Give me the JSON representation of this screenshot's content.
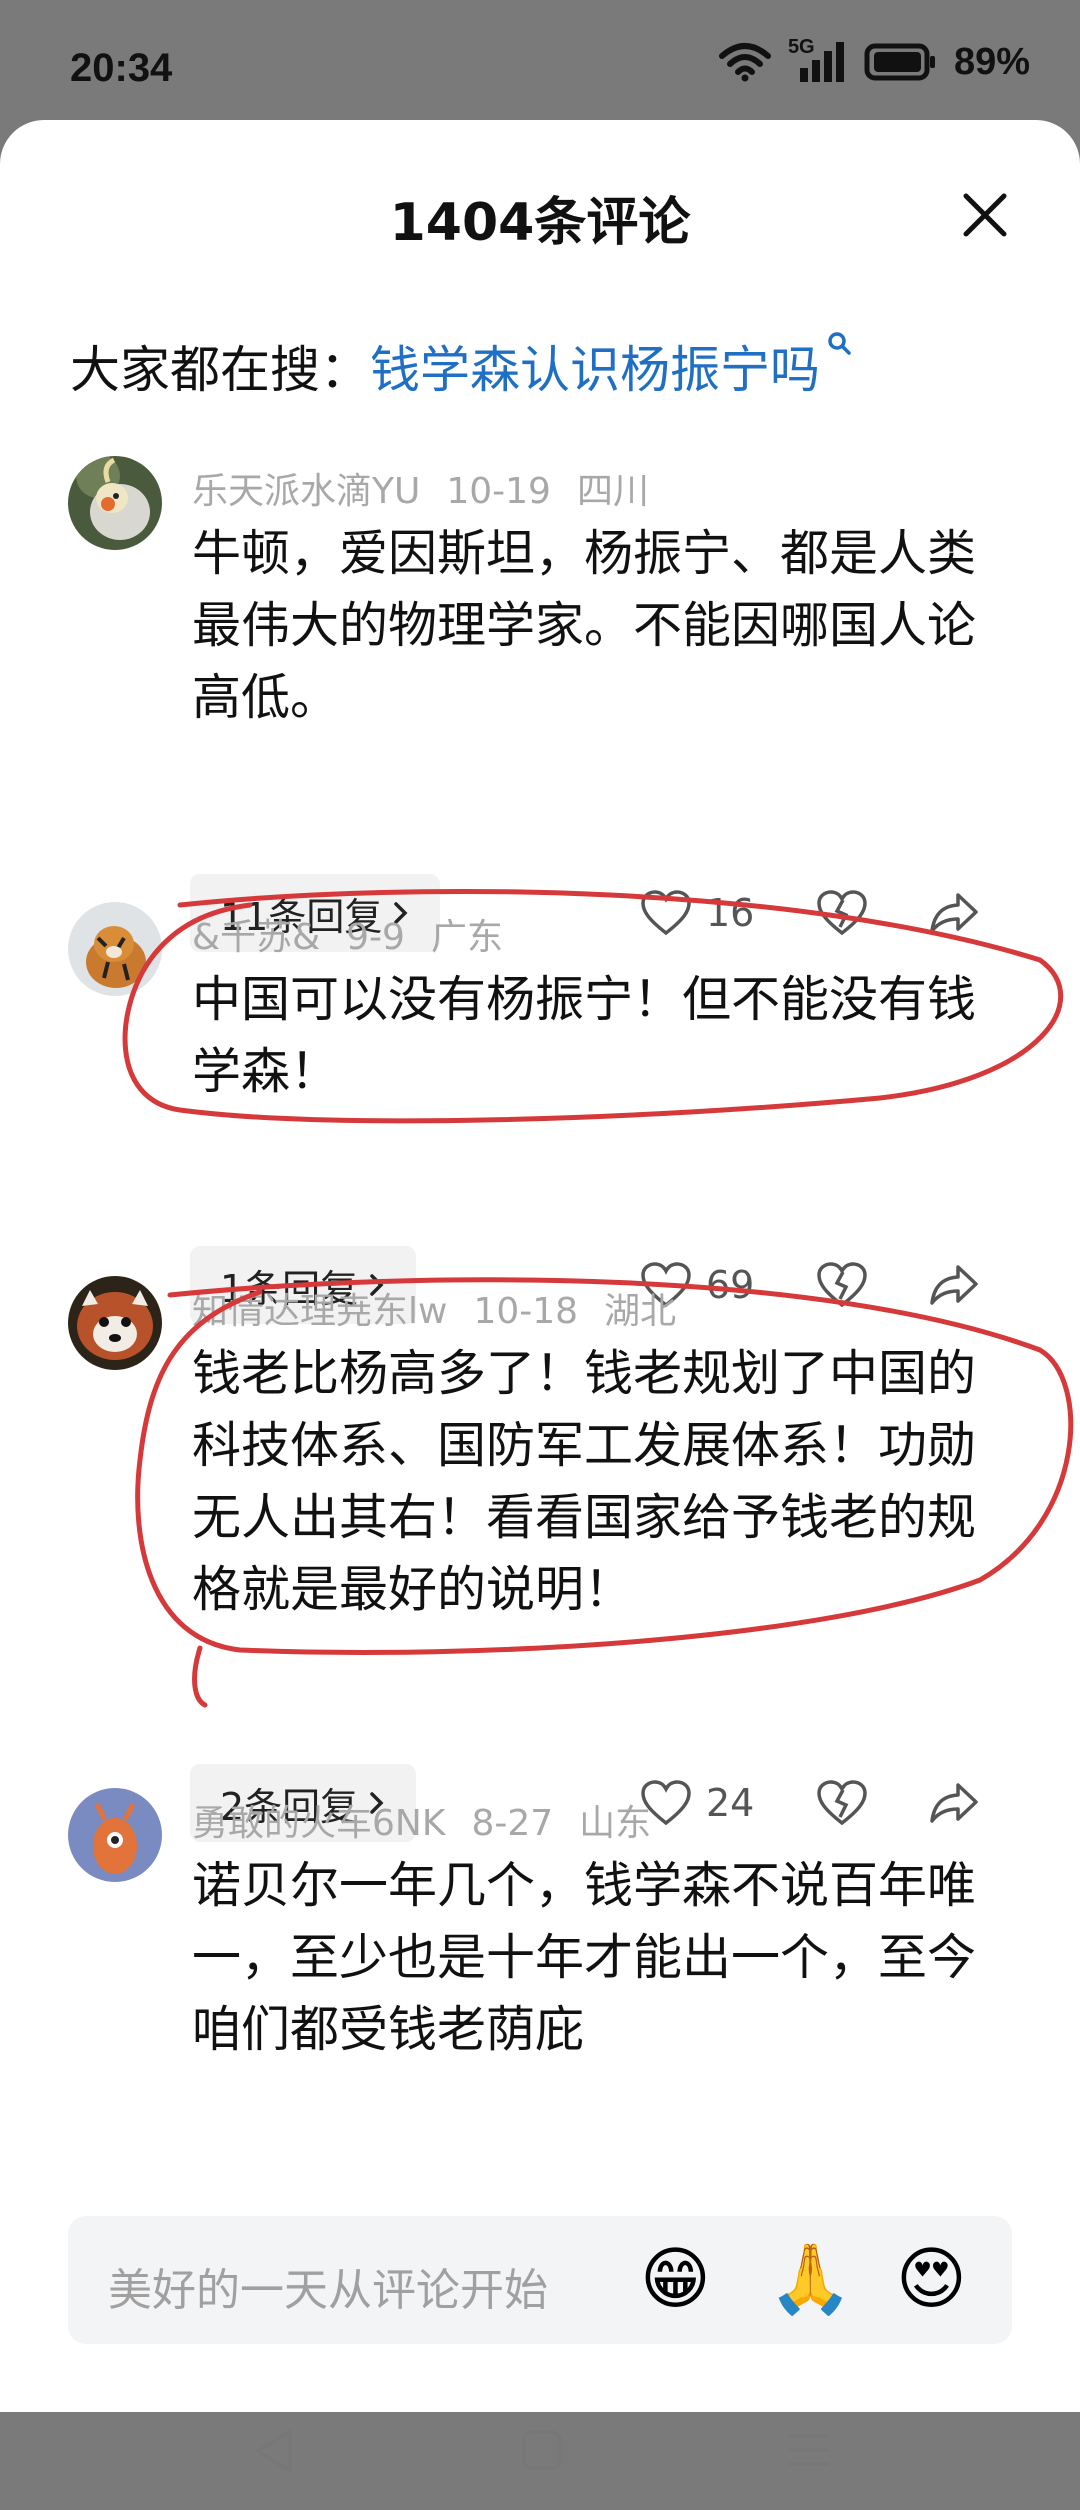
{
  "status_bar": {
    "time": "20:34",
    "network": "5G",
    "battery": "89%"
  },
  "sheet": {
    "title": "1404条评论",
    "search_prefix": "大家都在搜：",
    "search_query": "钱学森认识杨振宁吗"
  },
  "comments": [
    {
      "user": "乐天派水滴YU",
      "date": "10-19",
      "location": "四川",
      "text": "牛顿，爱因斯坦，杨振宁、都是人类最伟大的物理学家。不能因哪国人论高低。",
      "replies": "11条回复",
      "likes": "16"
    },
    {
      "user": "&千苏&",
      "date": "9-9",
      "location": "广东",
      "text": "中国可以没有杨振宁！但不能没有钱学森！",
      "replies": "1条回复",
      "likes": "69"
    },
    {
      "user": "知情达理尭东lw",
      "date": "10-18",
      "location": "湖北",
      "text": "钱老比杨高多了！钱老规划了中国的科技体系、国防军工发展体系！功勋无人出其右！看看国家给予钱老的规格就是最好的说明！",
      "replies": "2条回复",
      "likes": "24"
    },
    {
      "user": "勇敢的火车6NK",
      "date": "8-27",
      "location": "山东",
      "text": "诺贝尔一年几个，钱学森不说百年唯一，至少也是十年才能出一个，至今咱们都受钱老荫庇"
    }
  ],
  "input": {
    "placeholder": "美好的一天从评论开始"
  },
  "emojis": [
    "😁",
    "🙏",
    "😍"
  ],
  "colors": {
    "link": "#1f6fc4",
    "annotation": "#d6393a"
  },
  "icons": [
    "wifi-icon",
    "signal-icon",
    "battery-icon",
    "close-icon",
    "heart-icon",
    "dislike-icon",
    "share-icon",
    "chevron-right-icon",
    "back-nav-icon",
    "home-nav-icon",
    "menu-nav-icon"
  ]
}
